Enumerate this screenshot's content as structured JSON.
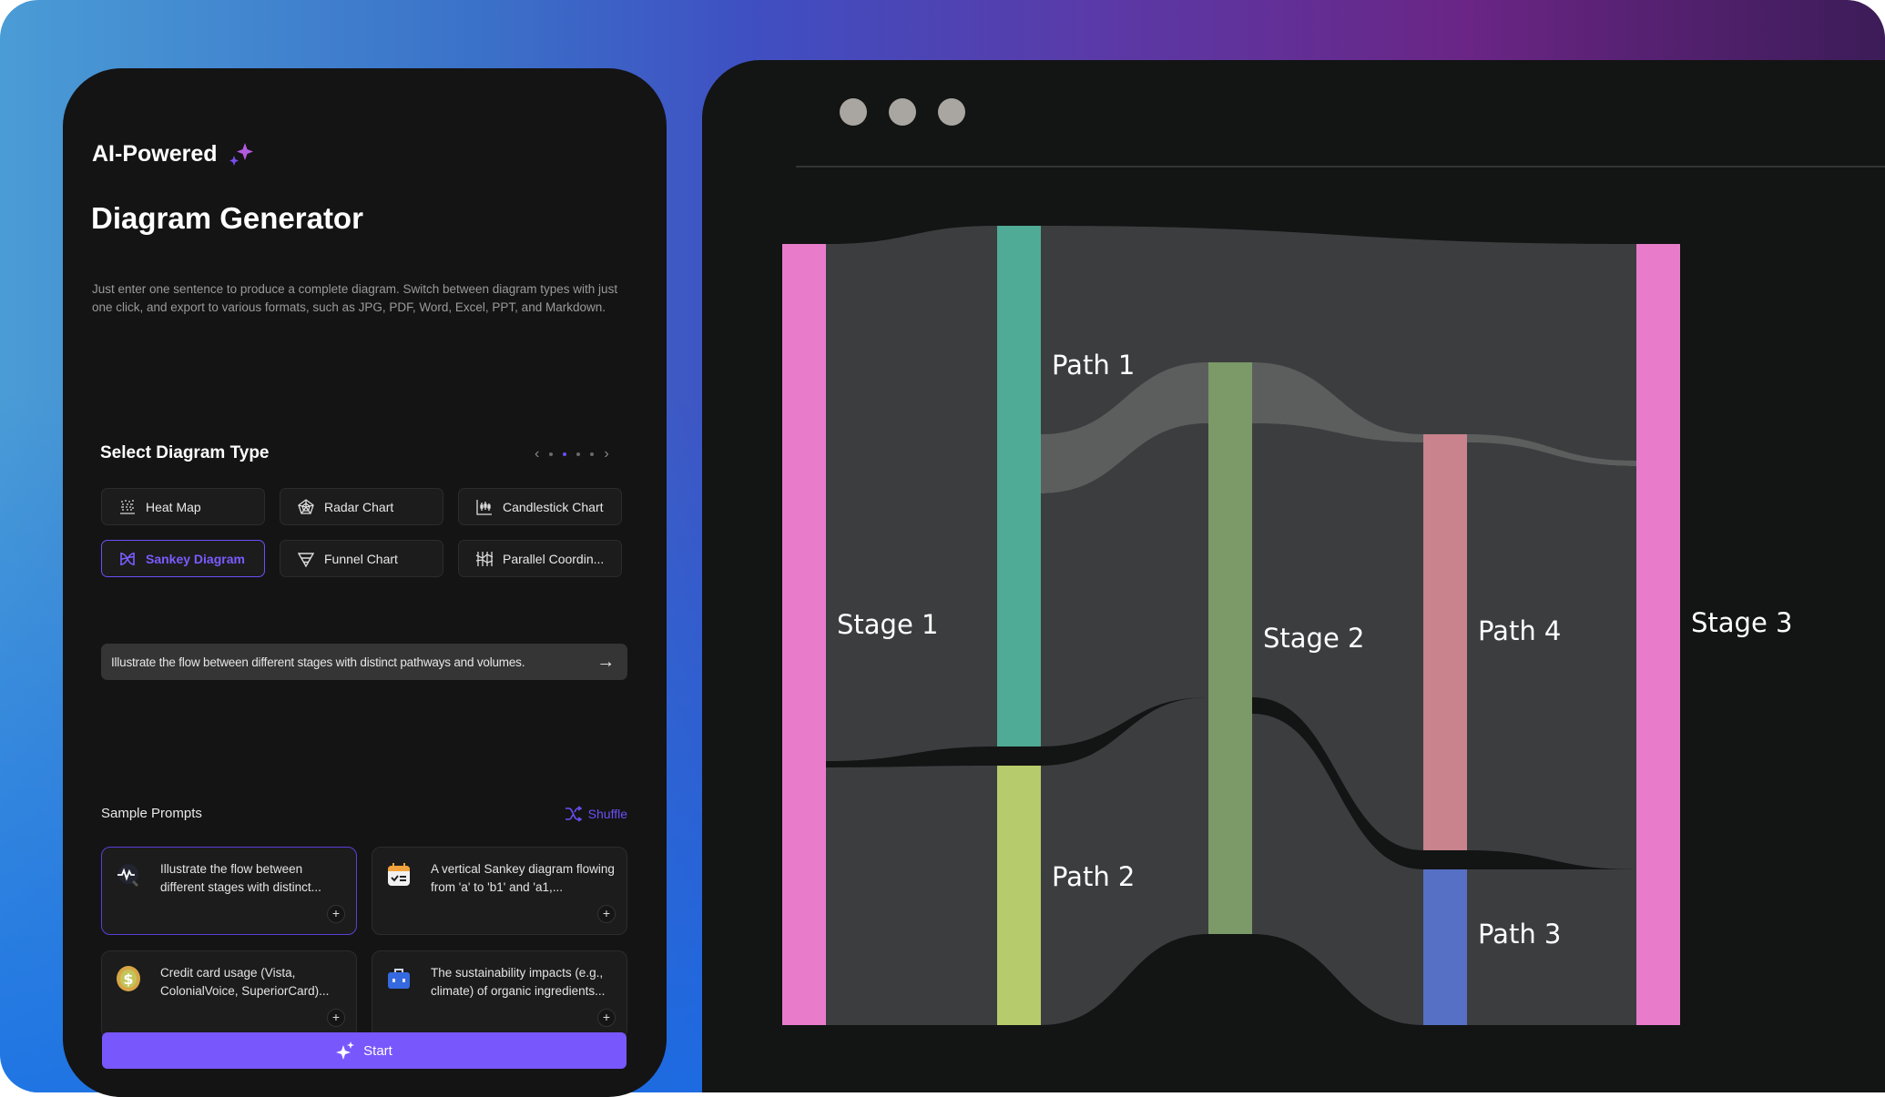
{
  "left": {
    "brand": "AI-Powered",
    "title": "Diagram Generator",
    "description": "Just enter one sentence to produce a complete diagram. Switch between diagram types with just one click, and export to various formats, such as JPG, PDF, Word, Excel, PPT, and Markdown.",
    "select_heading": "Select Diagram Type",
    "pager": {
      "pages": 4,
      "active_page": 2
    },
    "diagram_types": [
      {
        "label": "Heat Map",
        "icon": "heatmap-icon",
        "selected": false
      },
      {
        "label": "Radar Chart",
        "icon": "radar-chart-icon",
        "selected": false
      },
      {
        "label": "Candlestick Chart",
        "icon": "candlestick-chart-icon",
        "selected": false
      },
      {
        "label": "Sankey Diagram",
        "icon": "sankey-icon",
        "selected": true
      },
      {
        "label": "Funnel Chart",
        "icon": "funnel-chart-icon",
        "selected": false
      },
      {
        "label": "Parallel Coordin...",
        "icon": "parallel-coordinates-icon",
        "selected": false
      }
    ],
    "prompt_value": "Illustrate the flow between different stages with distinct pathways and volumes.",
    "samples_heading": "Sample Prompts",
    "shuffle_label": "Shuffle",
    "sample_prompts": [
      {
        "text": "Illustrate the flow between different stages with distinct...",
        "icon": "pulse-search-icon",
        "selected": true
      },
      {
        "text": "A vertical Sankey diagram flowing from 'a' to 'b1' and 'a1,...",
        "icon": "calendar-check-icon",
        "selected": false
      },
      {
        "text": "Credit card usage (Vista, ColonialVoice, SuperiorCard)...",
        "icon": "dollar-coin-icon",
        "selected": false
      },
      {
        "text": "The sustainability impacts (e.g., climate) of organic ingredients...",
        "icon": "briefcase-icon",
        "selected": false
      }
    ],
    "start_label": "Start"
  },
  "colors": {
    "accent": "#7857fc",
    "panel": "#141414",
    "link": "#3c3d3f",
    "link_highlight": "#5c5e5d"
  },
  "sankey": {
    "nodes": [
      {
        "id": "stage1",
        "label": "Stage 1",
        "color": "#e87ccb"
      },
      {
        "id": "path1",
        "label": "Path 1",
        "color": "#4fab95"
      },
      {
        "id": "path2",
        "label": "Path 2",
        "color": "#b5cb6c"
      },
      {
        "id": "stage2",
        "label": "Stage 2",
        "color": "#7b9a67"
      },
      {
        "id": "path4",
        "label": "Path 4",
        "color": "#c8838d"
      },
      {
        "id": "path3",
        "label": "Path 3",
        "color": "#5670c6"
      },
      {
        "id": "stage3",
        "label": "Stage 3",
        "color": "#e87ccb"
      }
    ],
    "links": [
      {
        "source": "stage1",
        "target": "path1",
        "value": 60
      },
      {
        "source": "stage1",
        "target": "path2",
        "value": 36
      },
      {
        "source": "path1",
        "target": "stage3",
        "value": 35
      },
      {
        "source": "path1",
        "target": "stage2",
        "value": 13
      },
      {
        "source": "path1",
        "target": "stage2",
        "value": 12
      },
      {
        "source": "path2",
        "target": "stage2",
        "value": 36
      },
      {
        "source": "stage2",
        "target": "path4",
        "value": 12
      },
      {
        "source": "stage2",
        "target": "path4",
        "value": 36
      },
      {
        "source": "stage2",
        "target": "path3",
        "value": 18
      },
      {
        "source": "path4",
        "target": "stage3",
        "value": 48
      },
      {
        "source": "path3",
        "target": "stage3",
        "value": 18
      }
    ]
  }
}
